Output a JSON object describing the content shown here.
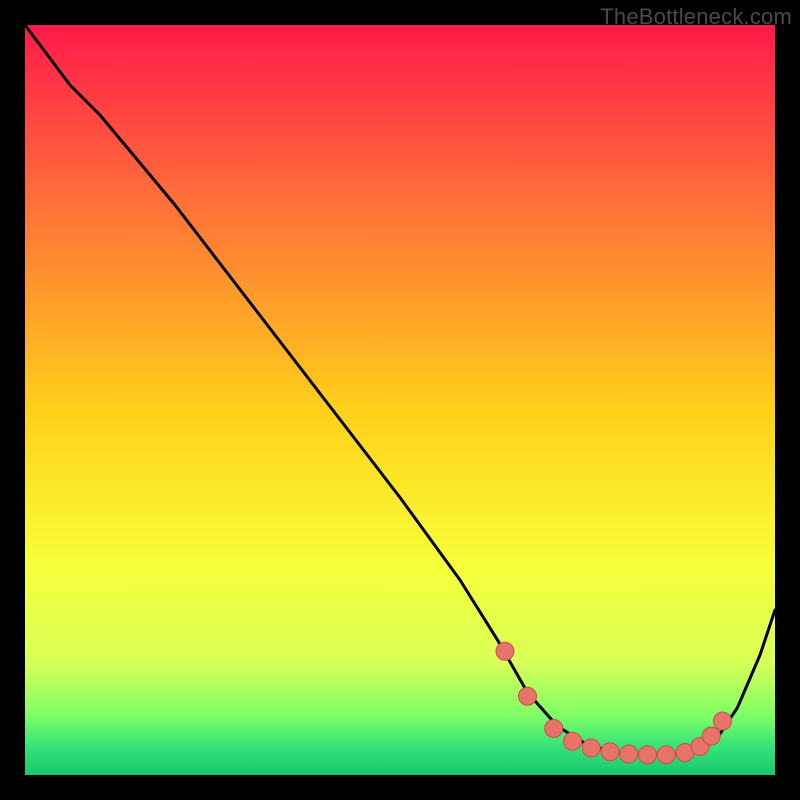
{
  "watermark": "TheBottleneck.com",
  "colors": {
    "bg": "#000000",
    "curve": "#000000",
    "marker_fill": "#e8736b",
    "marker_stroke": "#c94f49",
    "grad_top": "#ff1a4b",
    "grad_mid_upper": "#ff6a3a",
    "grad_mid": "#ffd21a",
    "grad_mid_lower": "#f7ff3a",
    "grad_low": "#d8ff57",
    "grad_green1": "#7fff66",
    "grad_green2": "#33e07a",
    "grad_bottom": "#18c86a"
  },
  "chart_data": {
    "type": "line",
    "title": "",
    "xlabel": "",
    "ylabel": "",
    "xlim": [
      0,
      100
    ],
    "ylim": [
      0,
      100
    ],
    "grid": false,
    "series": [
      {
        "name": "bottleneck-curve",
        "x": [
          0,
          6,
          10,
          20,
          30,
          40,
          50,
          58,
          63,
          67,
          71,
          75,
          79,
          83,
          86,
          89,
          92,
          95,
          98,
          100
        ],
        "y": [
          100,
          92,
          88,
          76,
          63,
          50,
          37,
          26,
          18,
          11,
          6.5,
          4,
          3,
          2.7,
          2.7,
          3,
          4.5,
          9,
          16,
          22
        ]
      }
    ],
    "markers": {
      "name": "optimal-range",
      "x": [
        64,
        67,
        70.5,
        73,
        75.5,
        78,
        80.5,
        83,
        85.5,
        88,
        90,
        91.5,
        93
      ],
      "y": [
        16.5,
        10.5,
        6.2,
        4.5,
        3.6,
        3.1,
        2.8,
        2.7,
        2.7,
        3.0,
        3.8,
        5.2,
        7.2
      ]
    }
  }
}
